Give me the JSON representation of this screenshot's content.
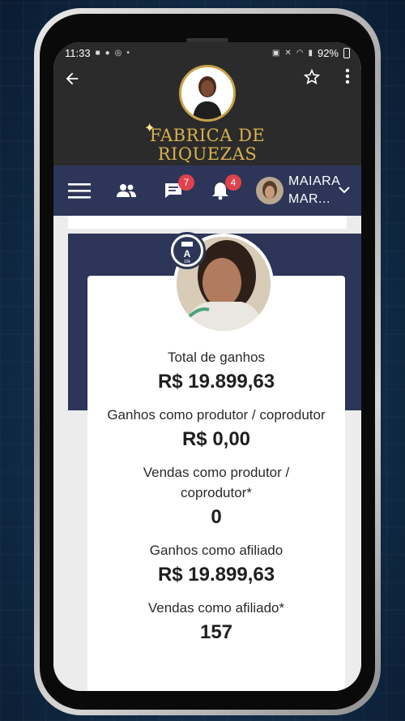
{
  "status_bar": {
    "time": "11:33",
    "left_icons": [
      "video-icon",
      "bubble-icon",
      "b-icon",
      "dot"
    ],
    "battery": "92%"
  },
  "app_bar": {
    "logo_line1": "FABRICA DE",
    "logo_line2": "RIQUEZAS",
    "colors": {
      "logo_gold": "#d8b24e",
      "bar_bg": "#2b2b2b"
    }
  },
  "nav": {
    "messages_badge": "7",
    "notifications_badge": "4",
    "user_line1": "MAIARA",
    "user_line2": "MAR...",
    "colors": {
      "nav_bg": "#2d3658",
      "badge": "#e0414a"
    }
  },
  "profile": {
    "tier_letter": "A",
    "tier_sub": "10k"
  },
  "stats": [
    {
      "label": "Total de ganhos",
      "value": "R$ 19.899,63"
    },
    {
      "label": "Ganhos como produtor / coprodutor",
      "value": "R$ 0,00"
    },
    {
      "label": "Vendas como produtor / coprodutor*",
      "value": "0"
    },
    {
      "label": "Ganhos como afiliado",
      "value": "R$ 19.899,63"
    },
    {
      "label": "Vendas como afiliado*",
      "value": "157"
    }
  ]
}
